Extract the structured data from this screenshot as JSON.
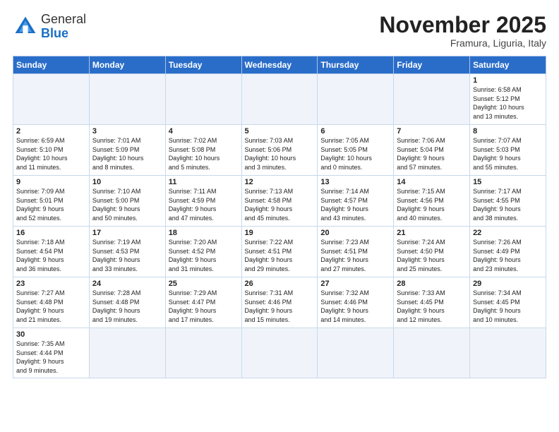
{
  "logo": {
    "general": "General",
    "blue": "Blue"
  },
  "title": "November 2025",
  "subtitle": "Framura, Liguria, Italy",
  "headers": [
    "Sunday",
    "Monday",
    "Tuesday",
    "Wednesday",
    "Thursday",
    "Friday",
    "Saturday"
  ],
  "weeks": [
    [
      {
        "day": "",
        "info": ""
      },
      {
        "day": "",
        "info": ""
      },
      {
        "day": "",
        "info": ""
      },
      {
        "day": "",
        "info": ""
      },
      {
        "day": "",
        "info": ""
      },
      {
        "day": "",
        "info": ""
      },
      {
        "day": "1",
        "info": "Sunrise: 6:58 AM\nSunset: 5:12 PM\nDaylight: 10 hours\nand 13 minutes."
      }
    ],
    [
      {
        "day": "2",
        "info": "Sunrise: 6:59 AM\nSunset: 5:10 PM\nDaylight: 10 hours\nand 11 minutes."
      },
      {
        "day": "3",
        "info": "Sunrise: 7:01 AM\nSunset: 5:09 PM\nDaylight: 10 hours\nand 8 minutes."
      },
      {
        "day": "4",
        "info": "Sunrise: 7:02 AM\nSunset: 5:08 PM\nDaylight: 10 hours\nand 5 minutes."
      },
      {
        "day": "5",
        "info": "Sunrise: 7:03 AM\nSunset: 5:06 PM\nDaylight: 10 hours\nand 3 minutes."
      },
      {
        "day": "6",
        "info": "Sunrise: 7:05 AM\nSunset: 5:05 PM\nDaylight: 10 hours\nand 0 minutes."
      },
      {
        "day": "7",
        "info": "Sunrise: 7:06 AM\nSunset: 5:04 PM\nDaylight: 9 hours\nand 57 minutes."
      },
      {
        "day": "8",
        "info": "Sunrise: 7:07 AM\nSunset: 5:03 PM\nDaylight: 9 hours\nand 55 minutes."
      }
    ],
    [
      {
        "day": "9",
        "info": "Sunrise: 7:09 AM\nSunset: 5:01 PM\nDaylight: 9 hours\nand 52 minutes."
      },
      {
        "day": "10",
        "info": "Sunrise: 7:10 AM\nSunset: 5:00 PM\nDaylight: 9 hours\nand 50 minutes."
      },
      {
        "day": "11",
        "info": "Sunrise: 7:11 AM\nSunset: 4:59 PM\nDaylight: 9 hours\nand 47 minutes."
      },
      {
        "day": "12",
        "info": "Sunrise: 7:13 AM\nSunset: 4:58 PM\nDaylight: 9 hours\nand 45 minutes."
      },
      {
        "day": "13",
        "info": "Sunrise: 7:14 AM\nSunset: 4:57 PM\nDaylight: 9 hours\nand 43 minutes."
      },
      {
        "day": "14",
        "info": "Sunrise: 7:15 AM\nSunset: 4:56 PM\nDaylight: 9 hours\nand 40 minutes."
      },
      {
        "day": "15",
        "info": "Sunrise: 7:17 AM\nSunset: 4:55 PM\nDaylight: 9 hours\nand 38 minutes."
      }
    ],
    [
      {
        "day": "16",
        "info": "Sunrise: 7:18 AM\nSunset: 4:54 PM\nDaylight: 9 hours\nand 36 minutes."
      },
      {
        "day": "17",
        "info": "Sunrise: 7:19 AM\nSunset: 4:53 PM\nDaylight: 9 hours\nand 33 minutes."
      },
      {
        "day": "18",
        "info": "Sunrise: 7:20 AM\nSunset: 4:52 PM\nDaylight: 9 hours\nand 31 minutes."
      },
      {
        "day": "19",
        "info": "Sunrise: 7:22 AM\nSunset: 4:51 PM\nDaylight: 9 hours\nand 29 minutes."
      },
      {
        "day": "20",
        "info": "Sunrise: 7:23 AM\nSunset: 4:51 PM\nDaylight: 9 hours\nand 27 minutes."
      },
      {
        "day": "21",
        "info": "Sunrise: 7:24 AM\nSunset: 4:50 PM\nDaylight: 9 hours\nand 25 minutes."
      },
      {
        "day": "22",
        "info": "Sunrise: 7:26 AM\nSunset: 4:49 PM\nDaylight: 9 hours\nand 23 minutes."
      }
    ],
    [
      {
        "day": "23",
        "info": "Sunrise: 7:27 AM\nSunset: 4:48 PM\nDaylight: 9 hours\nand 21 minutes."
      },
      {
        "day": "24",
        "info": "Sunrise: 7:28 AM\nSunset: 4:48 PM\nDaylight: 9 hours\nand 19 minutes."
      },
      {
        "day": "25",
        "info": "Sunrise: 7:29 AM\nSunset: 4:47 PM\nDaylight: 9 hours\nand 17 minutes."
      },
      {
        "day": "26",
        "info": "Sunrise: 7:31 AM\nSunset: 4:46 PM\nDaylight: 9 hours\nand 15 minutes."
      },
      {
        "day": "27",
        "info": "Sunrise: 7:32 AM\nSunset: 4:46 PM\nDaylight: 9 hours\nand 14 minutes."
      },
      {
        "day": "28",
        "info": "Sunrise: 7:33 AM\nSunset: 4:45 PM\nDaylight: 9 hours\nand 12 minutes."
      },
      {
        "day": "29",
        "info": "Sunrise: 7:34 AM\nSunset: 4:45 PM\nDaylight: 9 hours\nand 10 minutes."
      }
    ],
    [
      {
        "day": "30",
        "info": "Sunrise: 7:35 AM\nSunset: 4:44 PM\nDaylight: 9 hours\nand 9 minutes."
      },
      {
        "day": "",
        "info": ""
      },
      {
        "day": "",
        "info": ""
      },
      {
        "day": "",
        "info": ""
      },
      {
        "day": "",
        "info": ""
      },
      {
        "day": "",
        "info": ""
      },
      {
        "day": "",
        "info": ""
      }
    ]
  ]
}
